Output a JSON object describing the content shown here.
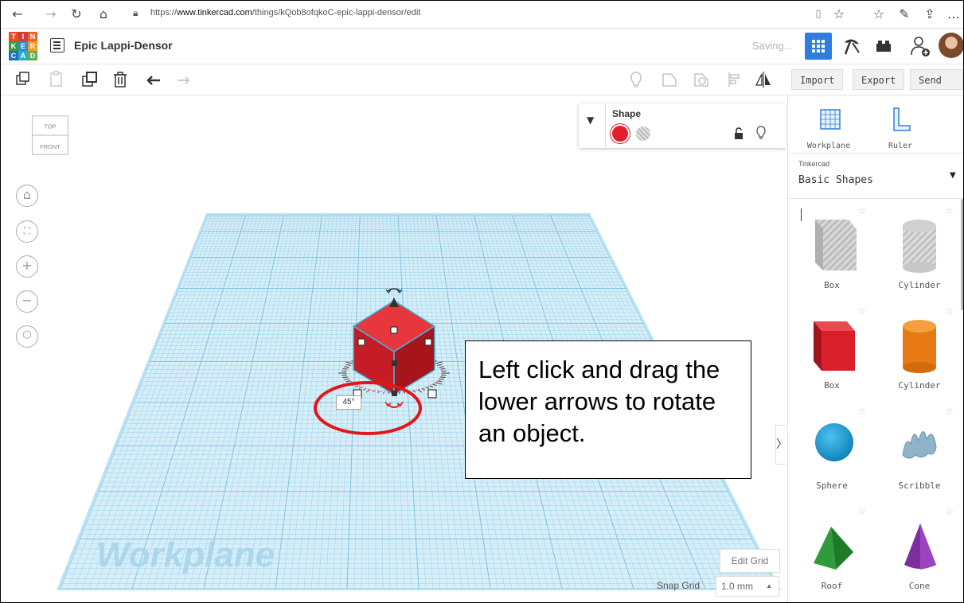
{
  "browser": {
    "url_prefix": "https://",
    "url_domain": "www.tinkercad.com",
    "url_path": "/things/kQob8ofqkoC-epic-lappi-densor/edit"
  },
  "app": {
    "logo_letters": [
      "T",
      "I",
      "N",
      "K",
      "E",
      "R",
      "C",
      "A",
      "D"
    ],
    "project_title": "Epic Lappi-Densor",
    "status": "Saving..."
  },
  "toolbar": {
    "import_label": "Import",
    "export_label": "Export",
    "send_to_label": "Send To"
  },
  "viewcube": {
    "top_label": "TOP",
    "front_label": "FRONT"
  },
  "inspector": {
    "title": "Shape",
    "solid_color": "#e3202a"
  },
  "rotation": {
    "angle_label": "45°"
  },
  "callout": {
    "text": "Left click and drag the lower arrows to rotate an object."
  },
  "workplane": {
    "watermark": "Workplane",
    "edit_grid_label": "Edit Grid",
    "snap_grid_label": "Snap Grid",
    "snap_grid_value": "1.0 mm"
  },
  "sidebar": {
    "tools": [
      {
        "label": "Workplane"
      },
      {
        "label": "Ruler"
      }
    ],
    "library_source": "Tinkercad",
    "library_name": "Basic Shapes",
    "shapes": [
      {
        "name": "Box",
        "icon": "box-hole-icon"
      },
      {
        "name": "Cylinder",
        "icon": "cylinder-hole-icon"
      },
      {
        "name": "Box",
        "icon": "box-icon"
      },
      {
        "name": "Cylinder",
        "icon": "cylinder-icon"
      },
      {
        "name": "Sphere",
        "icon": "sphere-icon"
      },
      {
        "name": "Scribble",
        "icon": "scribble-icon"
      },
      {
        "name": "Roof",
        "icon": "roof-icon"
      },
      {
        "name": "Cone",
        "icon": "cone-icon"
      }
    ]
  },
  "colors": {
    "accent": "#2e7de1",
    "grid": "#9fd3ea",
    "shape_red": "#d9202a"
  }
}
